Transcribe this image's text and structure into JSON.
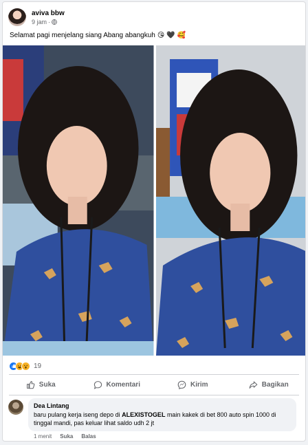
{
  "post": {
    "author": "aviva bbw",
    "time": "9 jam",
    "separator": "·",
    "caption": "Selamat pagi menjelang siang Abang abangkuh",
    "caption_emojis": [
      "😘",
      "🖤",
      "🥰"
    ]
  },
  "reactions": {
    "icons": [
      "like-icon",
      "haha-icon",
      "wow-icon"
    ],
    "count": "19"
  },
  "actions": {
    "like": "Suka",
    "comment": "Komentari",
    "send": "Kirim",
    "share": "Bagikan"
  },
  "comment": {
    "name": "Dea Lintang",
    "text_before": "baru pulang kerja iseng depo di ",
    "text_bold": "ALEXISTOGEL",
    "text_after": " main kakek di bet 800 auto spin 1000 di tinggal mandi, pas keluar lihat saldo udh 2 jt",
    "time": "1 menit",
    "like": "Suka",
    "reply": "Balas"
  },
  "colors": {
    "accent": "#1877f2",
    "secondary_text": "#65676b",
    "divider": "#ced0d4",
    "shirt": "#2f4f9e"
  }
}
